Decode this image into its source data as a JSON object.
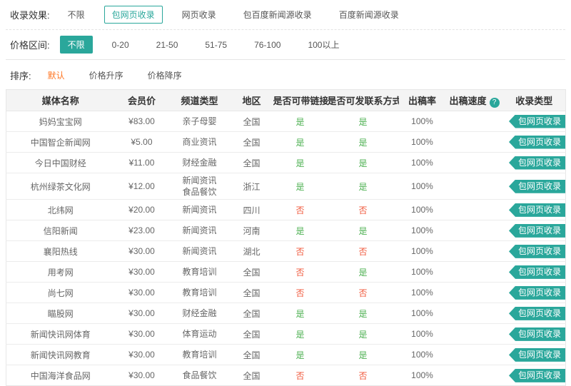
{
  "colors": {
    "accent": "#2aa79b",
    "yes": "#4cb050",
    "no": "#f0573a",
    "sort_active": "#ff7522"
  },
  "filters": {
    "effect": {
      "label": "收录效果:",
      "options": [
        {
          "text": "不限",
          "selected": false
        },
        {
          "text": "包网页收录",
          "selected": true
        },
        {
          "text": "网页收录",
          "selected": false
        },
        {
          "text": "包百度新闻源收录",
          "selected": false
        },
        {
          "text": "百度新闻源收录",
          "selected": false
        }
      ]
    },
    "price": {
      "label": "价格区间:",
      "options": [
        {
          "text": "不限",
          "selected": true
        },
        {
          "text": "0-20",
          "selected": false
        },
        {
          "text": "21-50",
          "selected": false
        },
        {
          "text": "51-75",
          "selected": false
        },
        {
          "text": "76-100",
          "selected": false
        },
        {
          "text": "100以上",
          "selected": false
        }
      ]
    },
    "sort": {
      "label": "排序:",
      "options": [
        {
          "text": "默认",
          "selected": true
        },
        {
          "text": "价格升序",
          "selected": false
        },
        {
          "text": "价格降序",
          "selected": false
        }
      ]
    }
  },
  "table": {
    "headers": [
      "媒体名称",
      "会员价",
      "频道类型",
      "地区",
      "是否可带链接",
      "是否可发联系方式",
      "出稿率",
      "出稿速度",
      "收录类型"
    ],
    "rows": [
      {
        "name": "妈妈宝宝网",
        "price": "¥83.00",
        "channel": "亲子母婴",
        "region": "全国",
        "can_link": "是",
        "can_contact": "是",
        "rate": "100%",
        "speed": "",
        "type": "包网页收录"
      },
      {
        "name": "中国智企新闻网",
        "price": "¥5.00",
        "channel": "商业资讯",
        "region": "全国",
        "can_link": "是",
        "can_contact": "是",
        "rate": "100%",
        "speed": "",
        "type": "包网页收录"
      },
      {
        "name": "今日中国财经",
        "price": "¥11.00",
        "channel": "财经金融",
        "region": "全国",
        "can_link": "是",
        "can_contact": "是",
        "rate": "100%",
        "speed": "",
        "type": "包网页收录"
      },
      {
        "name": "杭州绿茶文化网",
        "price": "¥12.00",
        "channel": "新闻资讯\n食品餐饮",
        "region": "浙江",
        "can_link": "是",
        "can_contact": "是",
        "rate": "100%",
        "speed": "",
        "type": "包网页收录"
      },
      {
        "name": "北纬网",
        "price": "¥20.00",
        "channel": "新闻资讯",
        "region": "四川",
        "can_link": "否",
        "can_contact": "否",
        "rate": "100%",
        "speed": "",
        "type": "包网页收录"
      },
      {
        "name": "信阳新闻",
        "price": "¥23.00",
        "channel": "新闻资讯",
        "region": "河南",
        "can_link": "是",
        "can_contact": "是",
        "rate": "100%",
        "speed": "",
        "type": "包网页收录"
      },
      {
        "name": "襄阳热线",
        "price": "¥30.00",
        "channel": "新闻资讯",
        "region": "湖北",
        "can_link": "否",
        "can_contact": "否",
        "rate": "100%",
        "speed": "",
        "type": "包网页收录"
      },
      {
        "name": "用考网",
        "price": "¥30.00",
        "channel": "教育培训",
        "region": "全国",
        "can_link": "否",
        "can_contact": "是",
        "rate": "100%",
        "speed": "",
        "type": "包网页收录"
      },
      {
        "name": "尚七网",
        "price": "¥30.00",
        "channel": "教育培训",
        "region": "全国",
        "can_link": "否",
        "can_contact": "否",
        "rate": "100%",
        "speed": "",
        "type": "包网页收录"
      },
      {
        "name": "瞄股网",
        "price": "¥30.00",
        "channel": "财经金融",
        "region": "全国",
        "can_link": "是",
        "can_contact": "是",
        "rate": "100%",
        "speed": "",
        "type": "包网页收录"
      },
      {
        "name": "新闻快讯网体育",
        "price": "¥30.00",
        "channel": "体育运动",
        "region": "全国",
        "can_link": "是",
        "can_contact": "是",
        "rate": "100%",
        "speed": "",
        "type": "包网页收录"
      },
      {
        "name": "新闻快讯网教育",
        "price": "¥30.00",
        "channel": "教育培训",
        "region": "全国",
        "can_link": "是",
        "can_contact": "是",
        "rate": "100%",
        "speed": "",
        "type": "包网页收录"
      },
      {
        "name": "中国海洋食品网",
        "price": "¥30.00",
        "channel": "食品餐饮",
        "region": "全国",
        "can_link": "否",
        "can_contact": "否",
        "rate": "100%",
        "speed": "",
        "type": "包网页收录"
      }
    ]
  }
}
